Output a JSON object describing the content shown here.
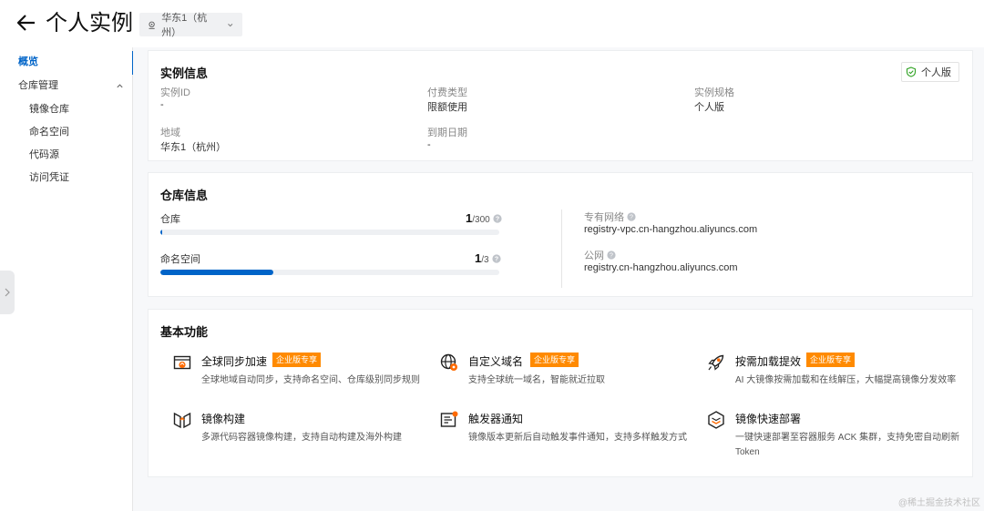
{
  "header": {
    "title": "个人实例",
    "region": "华东1（杭州）"
  },
  "sidebar": {
    "items": [
      {
        "label": "概览"
      },
      {
        "label": "仓库管理"
      },
      {
        "label": "镜像仓库"
      },
      {
        "label": "命名空间"
      },
      {
        "label": "代码源"
      },
      {
        "label": "访问凭证"
      }
    ]
  },
  "instance_info": {
    "title": "实例信息",
    "badge": "个人版",
    "fields": [
      {
        "label": "实例ID",
        "value": "-"
      },
      {
        "label": "付费类型",
        "value": "限额使用"
      },
      {
        "label": "实例规格",
        "value": "个人版"
      },
      {
        "label": "地域",
        "value": "华东1（杭州）"
      },
      {
        "label": "到期日期",
        "value": "-"
      }
    ]
  },
  "repo_info": {
    "title": "仓库信息",
    "stats": [
      {
        "label": "仓库",
        "used": "1",
        "max": "/300",
        "progress": 0.0033
      },
      {
        "label": "命名空间",
        "used": "1",
        "max": "/3",
        "progress": 0.3333
      }
    ],
    "networks": [
      {
        "label": "专有网络",
        "value": "registry-vpc.cn-hangzhou.aliyuncs.com"
      },
      {
        "label": "公网",
        "value": "registry.cn-hangzhou.aliyuncs.com"
      }
    ]
  },
  "features": {
    "title": "基本功能",
    "items": [
      {
        "icon": "global-sync-icon",
        "title": "全球同步加速",
        "tag": "企业版专享",
        "desc": "全球地域自动同步，支持命名空间、仓库级别同步规则"
      },
      {
        "icon": "custom-domain-icon",
        "title": "自定义域名",
        "tag": "企业版专享",
        "desc": "支持全球统一域名，智能就近拉取"
      },
      {
        "icon": "rocket-icon",
        "title": "按需加载提效",
        "tag": "企业版专享",
        "desc": "AI 大镜像按需加载和在线解压，大幅提高镜像分发效率"
      },
      {
        "icon": "image-build-icon",
        "title": "镜像构建",
        "tag": "",
        "desc": "多源代码容器镜像构建，支持自动构建及海外构建"
      },
      {
        "icon": "trigger-notify-icon",
        "title": "触发器通知",
        "tag": "",
        "desc": "镜像版本更新后自动触发事件通知，支持多样触发方式"
      },
      {
        "icon": "quick-deploy-icon",
        "title": "镜像快速部署",
        "tag": "",
        "desc": "一键快速部署至容器服务 ACK 集群，支持免密自动刷新 Token"
      }
    ]
  },
  "watermark": "@稀土掘金技术社区",
  "colors": {
    "accent": "#0064c8",
    "tag": "#ff8a00"
  }
}
